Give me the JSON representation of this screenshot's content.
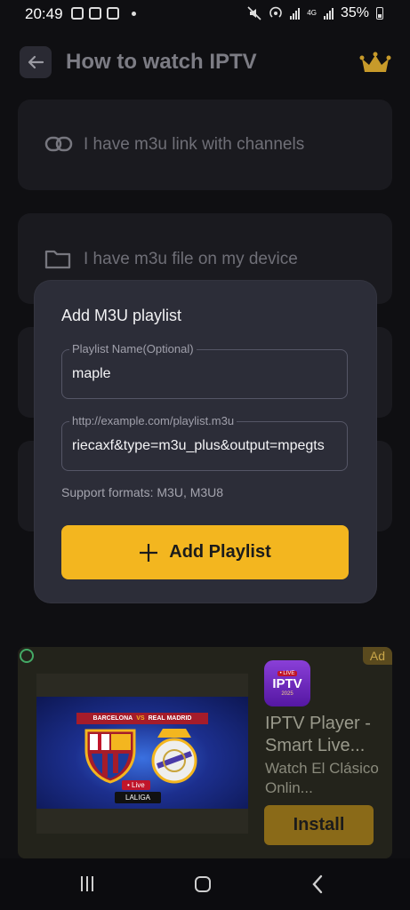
{
  "status_bar": {
    "time": "20:49",
    "battery": "35%",
    "network": "4G"
  },
  "header": {
    "title": "How to watch IPTV",
    "back_icon": "arrow-left-icon",
    "crown_icon": "crown-icon"
  },
  "options": [
    {
      "label": "I have m3u link with channels",
      "icon": "link-icon"
    },
    {
      "label": "I have m3u file on my device",
      "icon": "folder-icon"
    }
  ],
  "modal": {
    "title": "Add M3U playlist",
    "name_field": {
      "label": "Playlist Name(Optional)",
      "value": "maple"
    },
    "url_field": {
      "label": "http://example.com/playlist.m3u",
      "value": "riecaxf&type=m3u_plus&output=mpegts"
    },
    "support_text": "Support formats: M3U, M3U8",
    "add_button": "Add Playlist"
  },
  "ad": {
    "badge": "Ad",
    "banner_left": "BARCELONA",
    "banner_vs": "VS",
    "banner_right": "REAL MADRID",
    "live_tag": "• Live",
    "league": "LALIGA",
    "icon_live": "• LIVE",
    "icon_text": "IPTV",
    "icon_year": "2025",
    "title": "IPTV Player - Smart Live...",
    "description": "Watch El Clásico Onlin...",
    "install": "Install"
  },
  "colors": {
    "accent": "#f3b61f",
    "background": "#0f0f12",
    "modal": "#2c2d38"
  }
}
